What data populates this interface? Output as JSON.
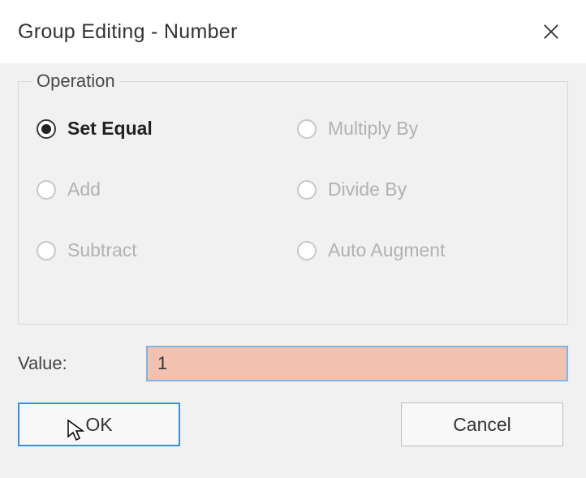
{
  "dialog": {
    "title": "Group Editing - Number"
  },
  "operation": {
    "legend": "Operation",
    "options": [
      {
        "label": "Set Equal",
        "selected": true,
        "enabled": true
      },
      {
        "label": "Multiply By",
        "selected": false,
        "enabled": false
      },
      {
        "label": "Add",
        "selected": false,
        "enabled": false
      },
      {
        "label": "Divide By",
        "selected": false,
        "enabled": false
      },
      {
        "label": "Subtract",
        "selected": false,
        "enabled": false
      },
      {
        "label": "Auto Augment",
        "selected": false,
        "enabled": false
      }
    ]
  },
  "value": {
    "label": "Value:",
    "input": "1"
  },
  "buttons": {
    "ok": "OK",
    "cancel": "Cancel"
  }
}
